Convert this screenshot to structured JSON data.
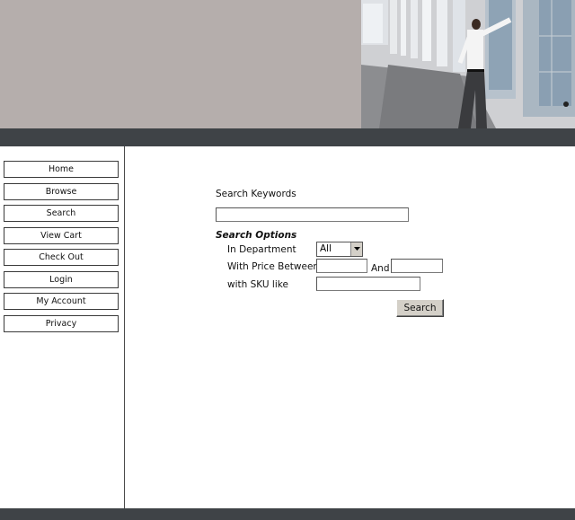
{
  "nav": {
    "items": [
      {
        "label": "Home"
      },
      {
        "label": "Browse"
      },
      {
        "label": "Search"
      },
      {
        "label": "View Cart"
      },
      {
        "label": "Check Out"
      },
      {
        "label": "Login"
      },
      {
        "label": "My Account"
      },
      {
        "label": "Privacy"
      }
    ]
  },
  "search": {
    "keywords_label": "Search Keywords",
    "keywords_value": "",
    "options_title": "Search Options",
    "department_label": "In Department",
    "department_selected": "All",
    "price_label": "With Price Between",
    "price_min_value": "",
    "and_label": "And",
    "price_max_value": "",
    "sku_label": "with SKU like",
    "sku_value": "",
    "button_label": "Search"
  },
  "colors": {
    "banner_bg": "#b5aeac",
    "bar_dark": "#3f4347",
    "button_face": "#d4d0c8"
  },
  "icons": {
    "dropdown": "chevron-down-icon"
  }
}
